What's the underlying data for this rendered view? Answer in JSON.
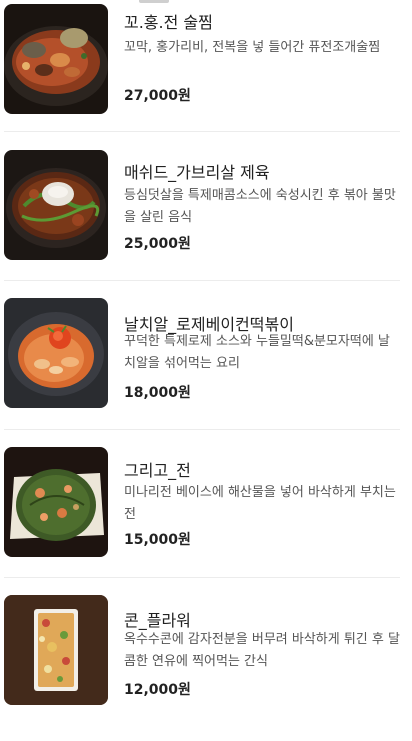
{
  "menu": {
    "items": [
      {
        "name": "꼬.홍.전 술찜",
        "description": "꼬막, 홍가리비, 전복을 넣 들어간 퓨전조개술찜",
        "price": "27,000원",
        "image": "seafood-stew-photo"
      },
      {
        "name": "매쉬드_가브리살 제육",
        "description": "등심덧살을 특제매콤소스에 숙성시킨 후 볶아 불맛을 살린 음식",
        "price": "25,000원",
        "image": "spicy-pork-photo"
      },
      {
        "name": "날치알_로제베이컨떡볶이",
        "description": "꾸덕한 특제로제 소스와 누들밀떡&분모자떡에 날치알을 섞어먹는 요리",
        "price": "18,000원",
        "image": "rose-tteokbokki-photo"
      },
      {
        "name": "그리고_전",
        "description": "미나리전 베이스에 해산물을 넣어 바삭하게 부치는 전",
        "price": "15,000원",
        "image": "seafood-pancake-photo"
      },
      {
        "name": "콘_플라워",
        "description": "옥수수콘에 감자전분을 버무려 바삭하게 튀긴 후 달콤한 연유에 찍어먹는 간식",
        "price": "12,000원",
        "image": "fried-corn-photo"
      }
    ]
  },
  "colors": {
    "text": "#222222",
    "description": "#555555",
    "divider": "#ececec"
  }
}
